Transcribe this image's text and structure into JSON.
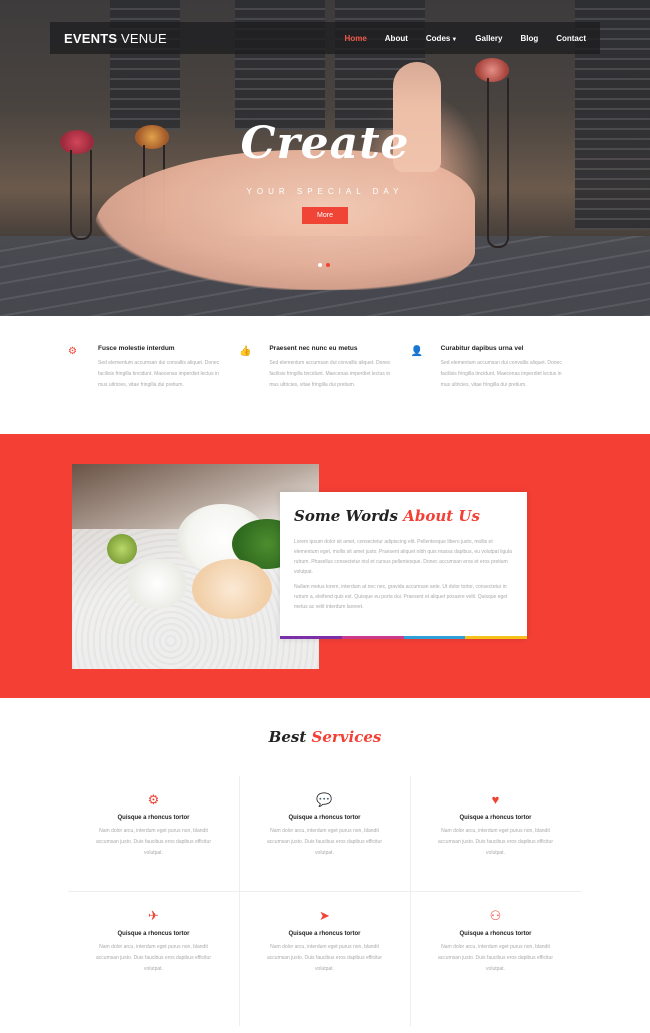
{
  "nav": {
    "logo_bold": "EVENTS",
    "logo_rest": " VENUE",
    "items": [
      {
        "label": "Home",
        "active": true
      },
      {
        "label": "About"
      },
      {
        "label": "Codes",
        "dropdown": true
      },
      {
        "label": "Gallery"
      },
      {
        "label": "Blog"
      },
      {
        "label": "Contact"
      }
    ]
  },
  "hero": {
    "title": "Create",
    "subtitle": "YOUR SPECIAL DAY",
    "button": "More",
    "slide_count": 2,
    "active_slide": 2
  },
  "features": [
    {
      "icon": "gear-icon",
      "title": "Fusce molestie interdum",
      "text": "Sed elementum accumsan dui convallis aliquet. Donec facilisis fringilla tincidunt. Maecenas imperdiet lectus in mus ultricies, vitae fringilla dui pretium."
    },
    {
      "icon": "thumbs-up-icon",
      "title": "Praesent nec nunc eu metus",
      "text": "Sed elementum accumsan dui convallis aliquet. Donec facilisis fringilla tincidunt. Maecenas imperdiet lectus in mus ultricies, vitae fringilla dui pretium."
    },
    {
      "icon": "user-icon",
      "title": "Curabitur dapibus urna vel",
      "text": "Sed elementum accumsan dui convallis aliquet. Donec facilisis fringilla tincidunt. Maecenas imperdiet lectus in mus ultricies, vitae fringilla dui pretium."
    }
  ],
  "about": {
    "title_black": "Some Words",
    "title_red": "About Us",
    "para1": "Lorem ipsum dolor sit amet, consectetur adipiscing elit. Pellentesque libero justo, mollis et elementum eget, mollis sit amet justo. Praesent aliquet nibh quis massa dapibus, eu volutpat ligula rutrum. Phasellus consectetur nisl et cursus pellentesque. Donec accumsan eros et eros pretium volutpat.",
    "para2": "Nullam metus lorem, interdum at nec nec, gravida accumsan ante. Ut dolor tortor, consectetur in rutrum a, eleifend quis est. Quisque eu porta dui. Praesent et aliquet posuere velit. Quisque eget metus ac velit interdum laoreet.",
    "rainbow_colors": [
      "#7b2fa8",
      "#c93a8c",
      "#2e9fd8",
      "#f5c21b"
    ]
  },
  "services": {
    "title_black": "Best",
    "title_red": "Services",
    "items": [
      {
        "icon": "gears-icon",
        "glyph": "⚙",
        "title": "Quisque a rhoncus tortor",
        "text": "Nam dolor arcu, interdum eget purus non, blandit accumsan justo. Duis faucibus eros dapibus efficitur volutpat."
      },
      {
        "icon": "comments-icon",
        "glyph": "💬",
        "title": "Quisque a rhoncus tortor",
        "text": "Nam dolor arcu, interdum eget purus non, blandit accumsan justo. Duis faucibus eros dapibus efficitur volutpat."
      },
      {
        "icon": "heart-icon",
        "glyph": "♥",
        "title": "Quisque a rhoncus tortor",
        "text": "Nam dolor arcu, interdum eget purus non, blandit accumsan justo. Duis faucibus eros dapibus efficitur volutpat."
      },
      {
        "icon": "plane-icon",
        "glyph": "✈",
        "title": "Quisque a rhoncus tortor",
        "text": "Nam dolor arcu, interdum eget purus non, blandit accumsan justo. Duis faucibus eros dapibus efficitur volutpat."
      },
      {
        "icon": "paper-plane-icon",
        "glyph": "➤",
        "title": "Quisque a rhoncus tortor",
        "text": "Nam dolor arcu, interdum eget purus non, blandit accumsan justo. Duis faucibus eros dapibus efficitur volutpat."
      },
      {
        "icon": "binoculars-icon",
        "glyph": "⚇",
        "title": "Quisque a rhoncus tortor",
        "text": "Nam dolor arcu, interdum eget purus non, blandit accumsan justo. Duis faucibus eros dapibus efficitur volutpat."
      }
    ]
  }
}
